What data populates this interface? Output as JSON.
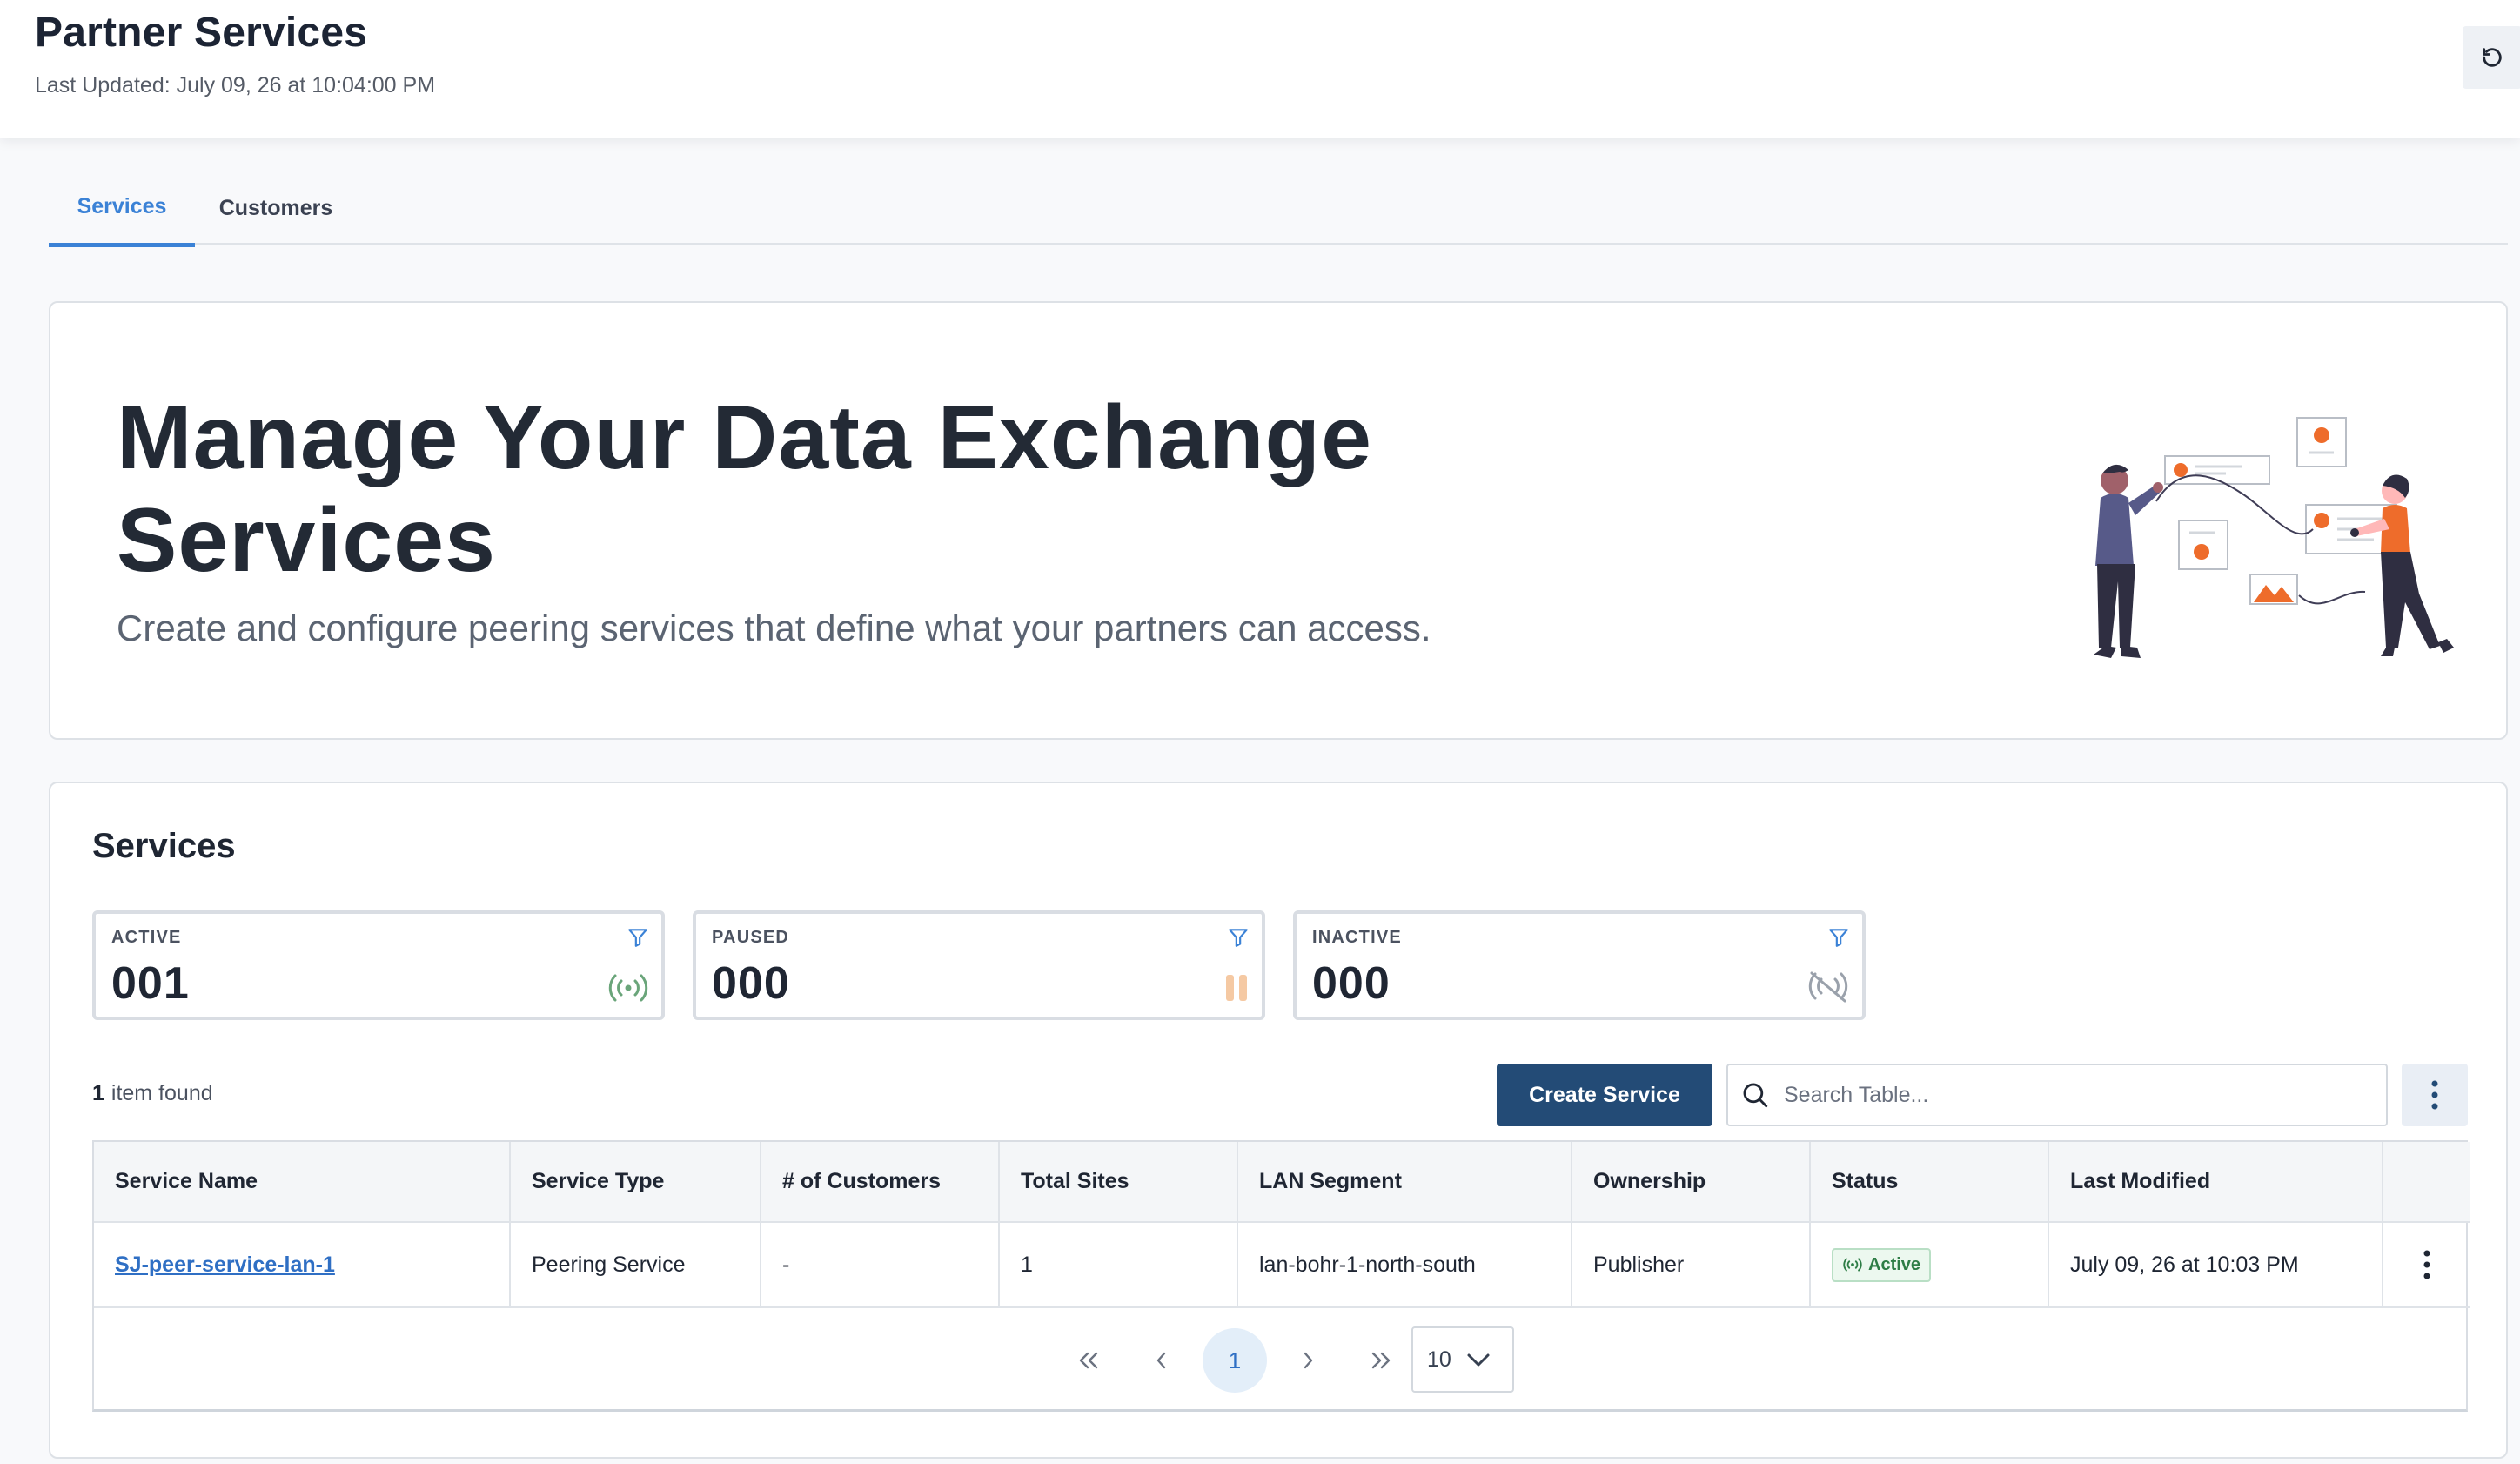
{
  "header": {
    "title": "Partner Services",
    "last_updated": "Last Updated: July 09, 26 at 10:04:00 PM",
    "refresh_icon": "refresh-icon"
  },
  "tabs": [
    {
      "label": "Services",
      "active": true
    },
    {
      "label": "Customers",
      "active": false
    }
  ],
  "hero": {
    "title": "Manage Your Data Exchange Services",
    "subtitle": "Create and configure peering services that define what your partners can access."
  },
  "services": {
    "title": "Services",
    "stats": [
      {
        "label": "ACTIVE",
        "value": "001",
        "icon": "broadcast-icon",
        "color": "#6aa57a"
      },
      {
        "label": "PAUSED",
        "value": "000",
        "icon": "pause-icon",
        "color": "#f5c9a3"
      },
      {
        "label": "INACTIVE",
        "value": "000",
        "icon": "broadcast-off-icon",
        "color": "#9aa1ab"
      }
    ],
    "items_count": "1",
    "items_found_label": "item found",
    "create_button": "Create Service",
    "search_placeholder": "Search Table...",
    "table": {
      "columns": [
        "Service Name",
        "Service Type",
        "# of Customers",
        "Total Sites",
        "LAN Segment",
        "Ownership",
        "Status",
        "Last Modified",
        ""
      ],
      "rows": [
        {
          "service_name": "SJ-peer-service-lan-1",
          "service_type": "Peering Service",
          "customers": "-",
          "total_sites": "1",
          "lan_segment": "lan-bohr-1-north-south",
          "ownership": "Publisher",
          "status": "Active",
          "last_modified": "July 09, 26 at 10:03 PM"
        }
      ]
    },
    "pagination": {
      "current_page": "1",
      "page_size": "10"
    }
  },
  "colors": {
    "accent": "#3b82d6",
    "primary_button": "#234b76",
    "status_active": "#2e7d46",
    "illustration_orange": "#ee6c2b"
  }
}
